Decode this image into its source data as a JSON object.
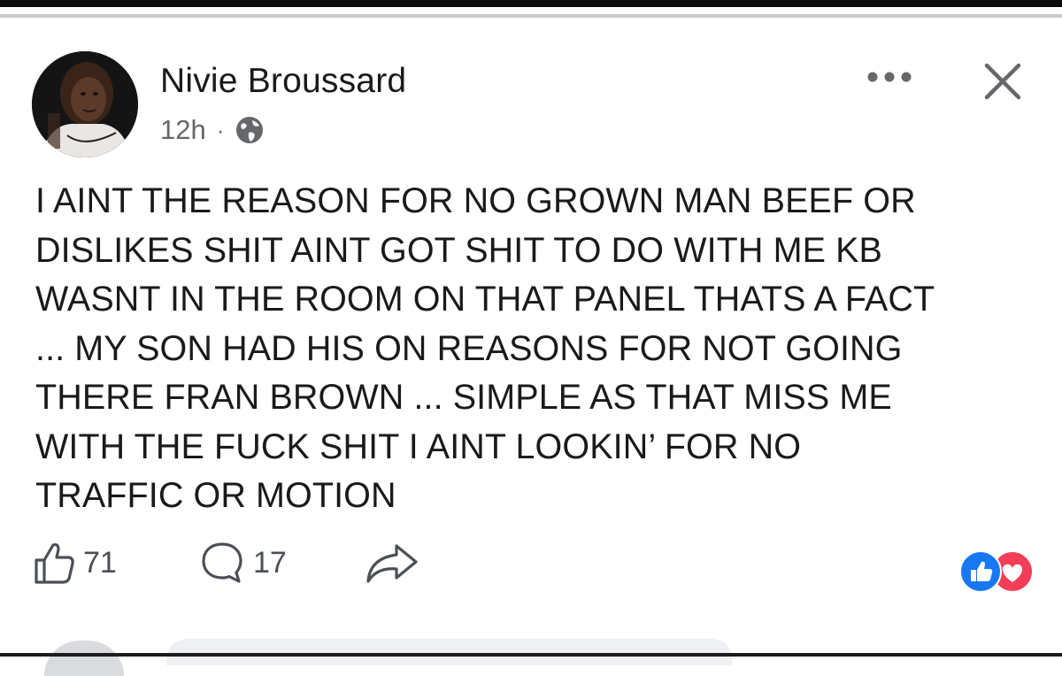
{
  "post": {
    "author": "Nivie Broussard",
    "time": "12h",
    "separator": "·",
    "audience_icon": "globe-icon",
    "text": "I AINT THE REASON FOR NO GROWN MAN BEEF OR\nDISLIKES SHIT AINT GOT SHIT TO DO WITH ME KB\nWASNT IN THE ROOM ON THAT PANEL THATS A FACT\n... MY SON HAD HIS ON REASONS FOR NOT GOING\nTHERE FRAN BROWN ... SIMPLE AS THAT MISS ME\nWITH THE FUCK SHIT I AINT LOOKIN’ FOR NO\nTRAFFIC OR MOTION"
  },
  "header_actions": {
    "more_icon": "more-dots-icon",
    "close_icon": "close-icon"
  },
  "actions": {
    "like_count": "71",
    "comment_count": "17",
    "like_icon": "thumbs-up-icon",
    "comment_icon": "comment-bubble-icon",
    "share_icon": "share-arrow-icon"
  },
  "reactions": {
    "types": [
      "like",
      "love"
    ],
    "colors": {
      "like": "#1877f2",
      "love": "#f33e58"
    }
  },
  "colors": {
    "text": "#1a1a1a",
    "secondary_text": "#65676b",
    "icon": "#4b4f56"
  }
}
